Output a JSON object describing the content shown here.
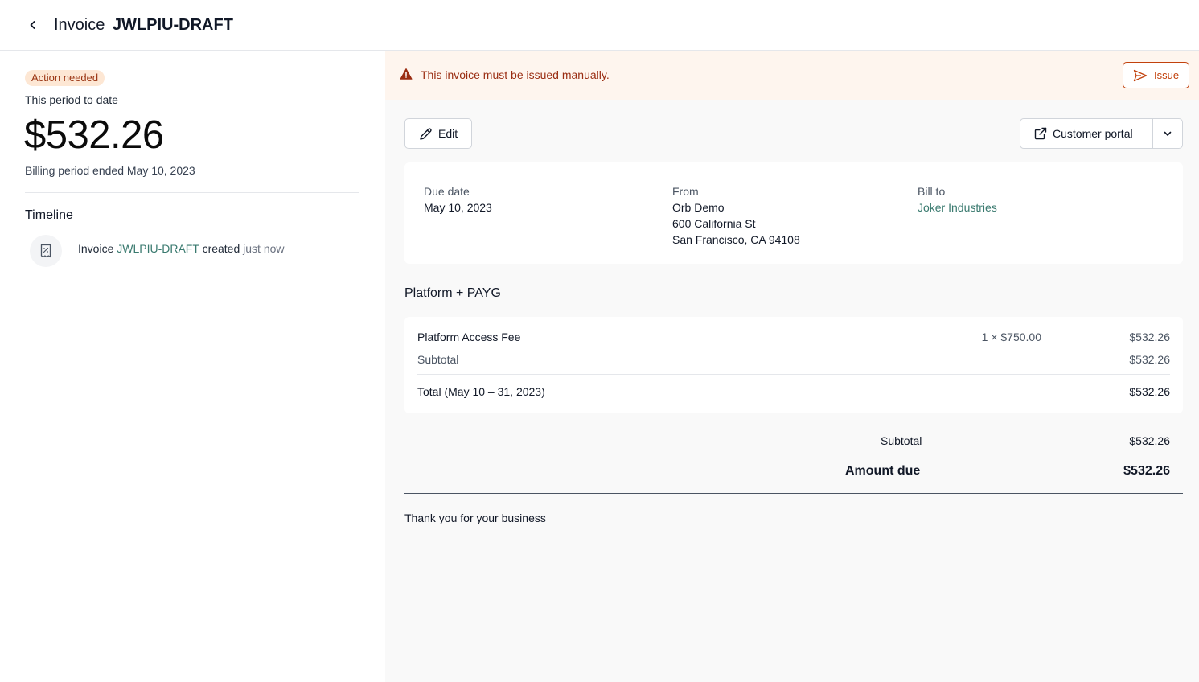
{
  "header": {
    "title_prefix": "Invoice",
    "invoice_id": "JWLPIU-DRAFT"
  },
  "left": {
    "badge": "Action needed",
    "period_label": "This period to date",
    "amount": "$532.26",
    "billing_period": "Billing period ended May 10, 2023",
    "timeline_title": "Timeline",
    "timeline": {
      "prefix": "Invoice",
      "invoice_link": "JWLPIU-DRAFT",
      "action": "created",
      "time": "just now"
    }
  },
  "alert": {
    "message": "This invoice must be issued manually.",
    "issue_label": "Issue"
  },
  "toolbar": {
    "edit_label": "Edit",
    "portal_label": "Customer portal"
  },
  "info": {
    "due_label": "Due date",
    "due_value": "May 10, 2023",
    "from_label": "From",
    "from_lines": [
      "Orb Demo",
      "600 California St",
      "San Francisco, CA 94108"
    ],
    "bill_label": "Bill to",
    "bill_value": "Joker Industries"
  },
  "plan": {
    "title": "Platform + PAYG",
    "item_name": "Platform Access Fee",
    "item_qty": "1 × $750.00",
    "item_amount": "$532.26",
    "subtotal_label": "Subtotal",
    "subtotal_amount": "$532.26",
    "total_label": "Total (May 10 – 31, 2023)",
    "total_amount": "$532.26"
  },
  "summary": {
    "subtotal_label": "Subtotal",
    "subtotal_amount": "$532.26",
    "due_label": "Amount due",
    "due_amount": "$532.26"
  },
  "footer": {
    "thanks": "Thank you for your business"
  },
  "colors": {
    "accent_link": "#3a7a6f",
    "warning": "#c2410c",
    "warning_bg": "#fef5ee",
    "badge_bg": "#fde7d4"
  }
}
